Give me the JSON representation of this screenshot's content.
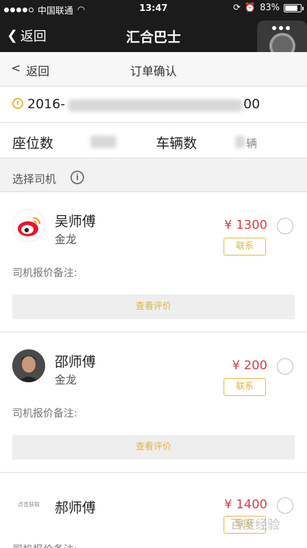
{
  "status_bar": {
    "carrier": "中国联通",
    "time": "13:47",
    "battery": "83%",
    "battery_level": 0.83
  },
  "wechat_bar": {
    "back_label": "返回",
    "title": "汇合巴士"
  },
  "page_bar": {
    "back_label": "返回",
    "title": "订单确认"
  },
  "trip": {
    "datetime": "2016-",
    "time_end": "00"
  },
  "seats": {
    "seat_label": "座位数",
    "vehicle_label": "车辆数",
    "vehicle_unit": "辆"
  },
  "section": {
    "choose_driver": "选择司机",
    "info_glyph": "i"
  },
  "drivers": [
    {
      "name": "吴师傅",
      "car": "金龙",
      "price": "¥ 1300",
      "contact": "联系",
      "note": "司机报价备注:",
      "review": "查看评价"
    },
    {
      "name": "邵师傅",
      "car": "金龙",
      "price": "¥ 200",
      "contact": "联系",
      "note": "司机报价备注:",
      "review": "查看评价"
    },
    {
      "name": "郝师傅",
      "avatar_text": "点击获取",
      "price": "¥ 1400",
      "contact": "联系",
      "note": "司机报价备注:"
    }
  ],
  "watermark": "百度经验",
  "colors": {
    "accent": "#e3b43c",
    "price": "#d0404a",
    "bar_bg": "#1b1b1b"
  }
}
